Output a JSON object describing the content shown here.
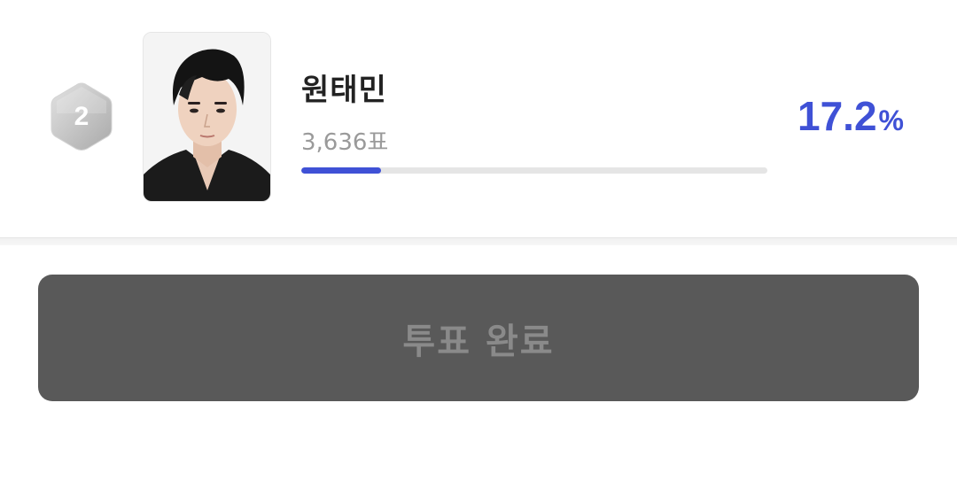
{
  "candidate": {
    "rank": "2",
    "name": "원태민",
    "votes": "3,636표",
    "percent_value": "17.2",
    "percent_unit": "%",
    "progress_fraction": 0.172
  },
  "button": {
    "label": "투표 완료"
  },
  "colors": {
    "accent": "#3f51d6",
    "badge_silver": "#bdbdbd",
    "button_bg": "#595959",
    "button_text": "#8a8a8a",
    "track": "#e5e5e5"
  },
  "icons": {
    "rank_badge": "hexagon-silver-icon",
    "candidate_photo": "portrait-photo"
  }
}
